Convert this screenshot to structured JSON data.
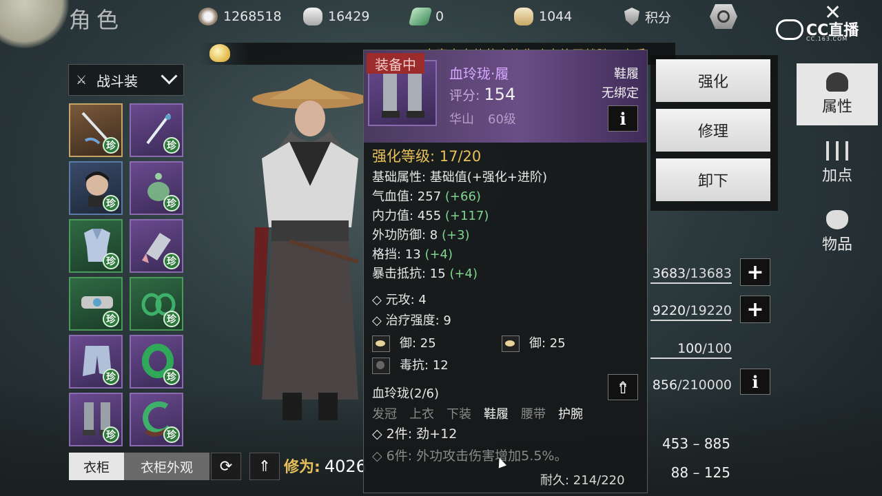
{
  "header": {
    "title": "角色",
    "currencies": [
      {
        "icon": "coin-icon",
        "value": "1268518"
      },
      {
        "icon": "silver-icon",
        "value": "16429"
      },
      {
        "icon": "jade-icon",
        "value": "0"
      },
      {
        "icon": "ingot-icon",
        "value": "1044"
      }
    ],
    "points_label": "积分",
    "watermark": "CC直播",
    "watermark_sub": "CC.163.COM"
  },
  "marquee": {
    "text": "步骞水少侠使出毕生功夫终于战胜了高手"
  },
  "outfit": {
    "selected": "战斗装"
  },
  "rare_badge": "珍",
  "bottom": {
    "wardrobe_tab": "衣柜",
    "wardrobe_look_tab": "衣柜外观",
    "cultivation_label": "修为:",
    "cultivation_value": "4026"
  },
  "tooltip": {
    "equipped_tag": "装备中",
    "name": "血玲珑·履",
    "slot": "鞋履",
    "score_label": "评分:",
    "score": "154",
    "bind": "无绑定",
    "sect": "华山",
    "level": "60级",
    "enhance_level": "强化等级: 17/20",
    "base_attr_title": "基础属性: 基础值(+强化+进阶)",
    "attrs": [
      {
        "label": "气血值: 257",
        "bonus": "(+66)"
      },
      {
        "label": "内力值: 455",
        "bonus": "(+117)"
      },
      {
        "label": "外功防御: 8",
        "bonus": "(+3)"
      },
      {
        "label": "格挡: 13",
        "bonus": "(+4)"
      },
      {
        "label": "暴击抵抗: 15",
        "bonus": "(+4)"
      }
    ],
    "extra": [
      "元攻: 4",
      "治疗强度: 9"
    ],
    "gems": [
      {
        "text": "御: 25"
      },
      {
        "text": "御: 25"
      },
      {
        "text": "毒抗: 12"
      }
    ],
    "set_name": "血玲珑(2/6)",
    "set_parts": [
      "发冠",
      "上衣",
      "下装",
      "鞋履",
      "腰带",
      "护腕"
    ],
    "set_bonus_2": "2件: 劲+12",
    "set_bonus_6": "6件: 外功攻击伤害增加5.5%。",
    "durability": "耐久: 214/220"
  },
  "actions": {
    "enhance": "强化",
    "repair": "修理",
    "unequip": "卸下"
  },
  "stats": {
    "hp": {
      "cur": "3683",
      "max": "/13683"
    },
    "mp": {
      "cur": "9220",
      "max": "/19220"
    },
    "third": {
      "cur": "100",
      "max": "/100"
    },
    "exp": {
      "cur": "856",
      "max": "/210000"
    },
    "attack_range_1": "453 – 885",
    "attack_range_2": "88 – 125"
  },
  "side_tabs": {
    "attributes": "属性",
    "add_points": "加点",
    "items": "物品"
  }
}
